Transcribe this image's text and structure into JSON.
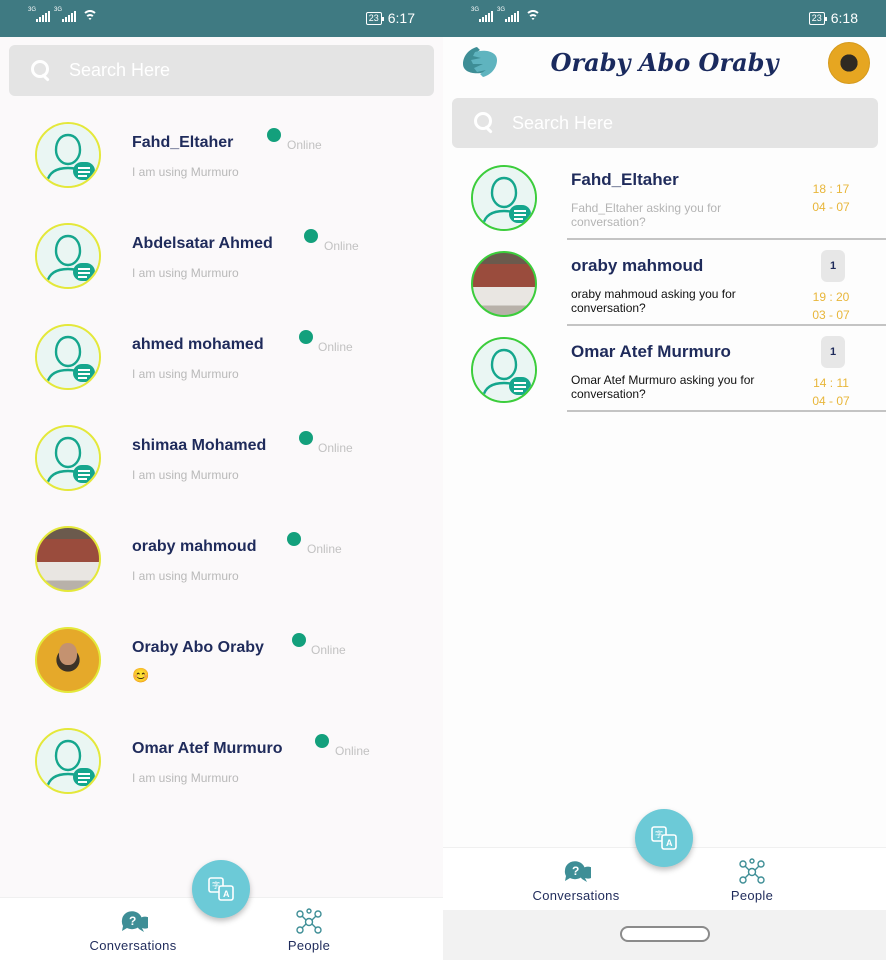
{
  "left": {
    "status_bar": {
      "signal1": "3G",
      "signal2": "3G",
      "battery": "23",
      "time": "6:17"
    },
    "search": {
      "placeholder": "Search Here"
    },
    "contacts": [
      {
        "name": "Fahd_Eltaher",
        "status": "I am using Murmuro",
        "presence": "Online"
      },
      {
        "name": "Abdelsatar Ahmed",
        "status": "I am using Murmuro",
        "presence": "Online"
      },
      {
        "name": "ahmed mohamed",
        "status": "I am using Murmuro",
        "presence": "Online"
      },
      {
        "name": "shimaa Mohamed",
        "status": "I am using Murmuro",
        "presence": "Online"
      },
      {
        "name": "oraby mahmoud",
        "status": "I am using Murmuro",
        "presence": "Online"
      },
      {
        "name": "Oraby Abo Oraby",
        "status": "😊",
        "presence": "Online"
      },
      {
        "name": "Omar Atef Murmuro",
        "status": "I am using Murmuro",
        "presence": "Online"
      }
    ],
    "nav": {
      "conversations": "Conversations",
      "people": "People"
    }
  },
  "right": {
    "status_bar": {
      "signal1": "3G",
      "signal2": "3G",
      "battery": "23",
      "time": "6:18"
    },
    "header": {
      "title": "Oraby Abo Oraby"
    },
    "search": {
      "placeholder": "Search Here"
    },
    "conversations": [
      {
        "name": "Fahd_Eltaher",
        "message": "Fahd_Eltaher  asking you for conversation?",
        "time": "18 : 17",
        "date": "04 - 07",
        "badge": ""
      },
      {
        "name": "oraby mahmoud",
        "message": "oraby mahmoud asking you for conversation?",
        "time": "19 : 20",
        "date": "03 - 07",
        "badge": "1"
      },
      {
        "name": "Omar Atef Murmuro",
        "message": "Omar Atef Murmuro asking you for conversation?",
        "time": "14 : 11",
        "date": "04 - 07",
        "badge": "1"
      }
    ],
    "nav": {
      "conversations": "Conversations",
      "people": "People"
    }
  },
  "colors": {
    "status_bar": "#3f7a82",
    "accent_teal": "#6ccad7",
    "name_navy": "#1f2b5b",
    "online_dot": "#13a07c",
    "time_yellow": "#e8b63a"
  },
  "icons": {
    "app_logo": "sign-language-hands-icon",
    "fab": "translate-icon",
    "conversations": "question-chat-icon",
    "people": "people-network-icon",
    "contact_avatar": "person-chat-avatar-icon"
  }
}
